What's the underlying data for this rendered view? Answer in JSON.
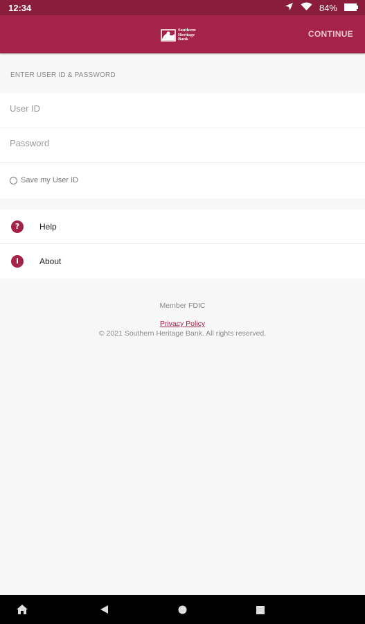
{
  "status_bar": {
    "time": "12:34",
    "battery": "84%",
    "icons": [
      "location-icon",
      "wifi-icon",
      "battery-icon"
    ]
  },
  "app_bar": {
    "logo_alt": [
      "Southern",
      "Heritage",
      "Bank"
    ],
    "continue_label": "CONTINUE"
  },
  "login": {
    "section_title": "ENTER USER ID & PASSWORD",
    "user_id_placeholder": "User ID",
    "user_id_value": "",
    "password_placeholder": "Password",
    "password_value": "",
    "save_label": "Save my User ID"
  },
  "menu": {
    "items": [
      {
        "label": "Help",
        "icon": "help-icon",
        "glyph": "?"
      },
      {
        "label": "About",
        "icon": "info-icon",
        "glyph": "i"
      }
    ]
  },
  "footer": {
    "member": "Member FDIC",
    "privacy": "Privacy Policy",
    "copyright": "© 2021 Southern Heritage Bank. All rights reserved."
  },
  "nav_bar": {
    "buttons": [
      "home-assistant-icon",
      "back-icon",
      "home-icon",
      "recents-icon"
    ]
  },
  "colors": {
    "brand": "#a3234a",
    "status_bar": "#8a1d3b",
    "background": "#f7f7f7"
  }
}
